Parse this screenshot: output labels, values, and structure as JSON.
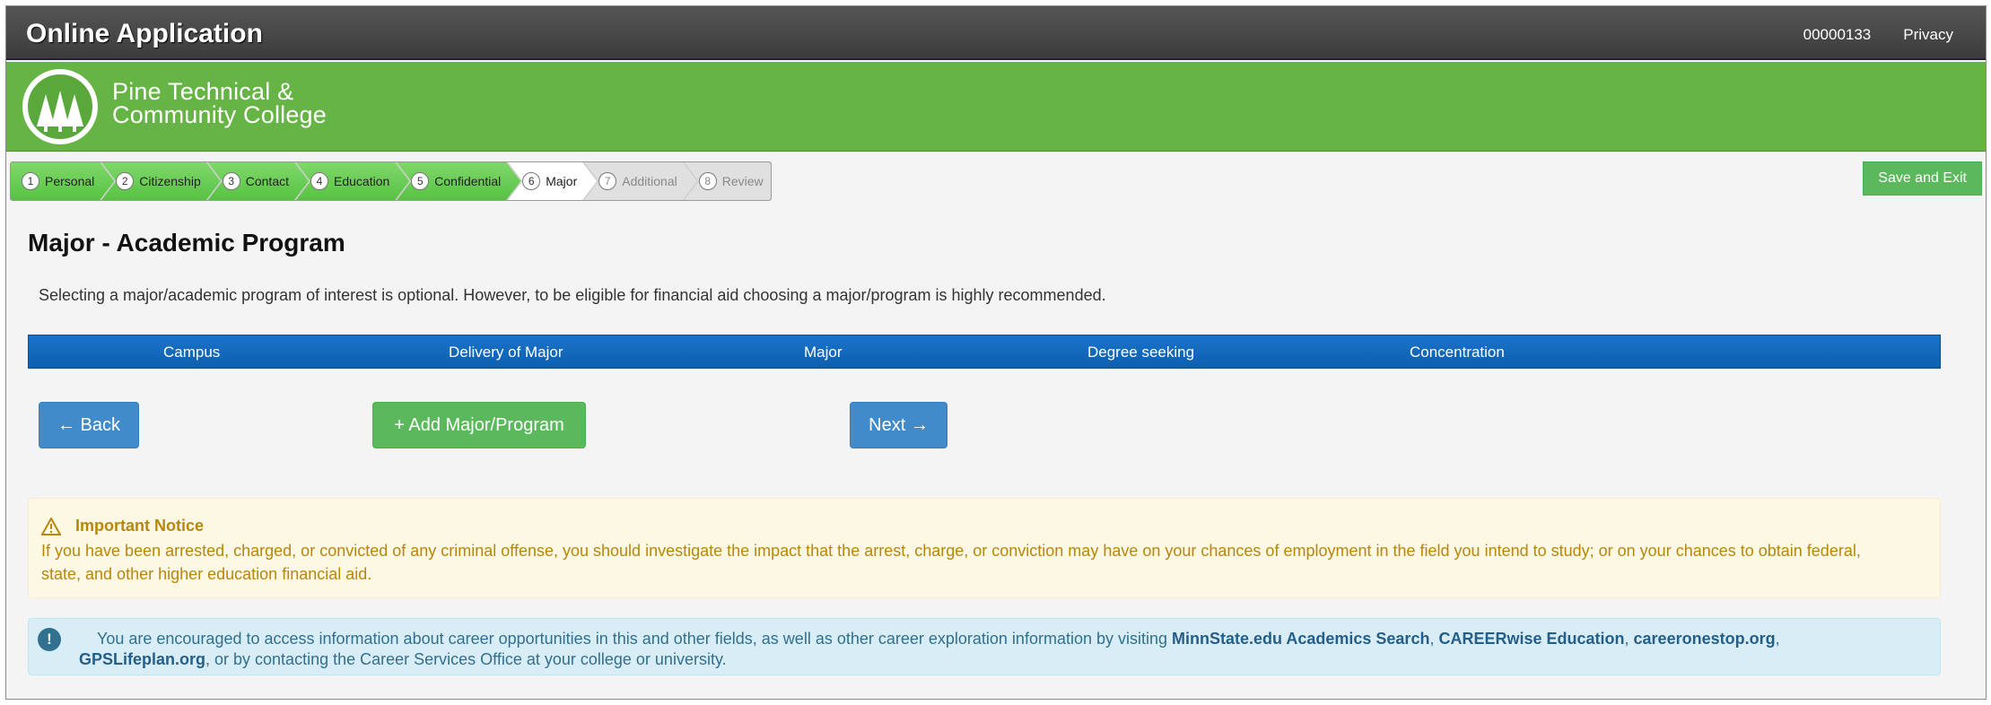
{
  "header": {
    "app_title": "Online Application",
    "application_id": "00000133",
    "privacy_link": "Privacy"
  },
  "brand": {
    "college_name_line1": "Pine Technical &",
    "college_name_line2": "Community College",
    "banner_color": "#66b445"
  },
  "steps": [
    {
      "num": "1",
      "label": "Personal",
      "state": "done"
    },
    {
      "num": "2",
      "label": "Citizenship",
      "state": "done"
    },
    {
      "num": "3",
      "label": "Contact",
      "state": "done"
    },
    {
      "num": "4",
      "label": "Education",
      "state": "done"
    },
    {
      "num": "5",
      "label": "Confidential",
      "state": "done"
    },
    {
      "num": "6",
      "label": "Major",
      "state": "current"
    },
    {
      "num": "7",
      "label": "Additional",
      "state": "todo"
    },
    {
      "num": "8",
      "label": "Review",
      "state": "todo"
    }
  ],
  "save_exit_label": "Save and Exit",
  "main": {
    "title": "Major - Academic Program",
    "intro": "Selecting a major/academic program of interest is optional. However, to be eligible for financial aid choosing a major/program is highly recommended.",
    "table_headers": [
      "Campus",
      "Delivery of Major",
      "Major",
      "Degree seeking",
      "Concentration"
    ]
  },
  "buttons": {
    "back": "← Back",
    "add": "+ Add Major/Program",
    "next": "Next →"
  },
  "notice": {
    "heading": "Important Notice",
    "text": "If you have been arrested, charged, or convicted of any criminal offense, you should investigate the impact that the arrest, charge, or conviction may have on your chances of employment in the field you intend to study; or on your chances to obtain federal, state, and other higher education financial aid."
  },
  "info": {
    "text_before": "You are encouraged to access information about career opportunities in this and other fields, as well as other career exploration information by visiting ",
    "link1": "MinnState.edu Academics Search",
    "sep1": ", ",
    "link2": "CAREERwise Education",
    "sep2": ", ",
    "link3": "careeronestop.org",
    "sep3": ",",
    "link4": "GPSLifeplan.org",
    "text_after": ", or by contacting the Career Services Office at your college or university."
  },
  "icons": {
    "warning": "warning-triangle-icon",
    "info": "exclamation-circle-icon",
    "logo": "pine-trees-logo-icon"
  }
}
